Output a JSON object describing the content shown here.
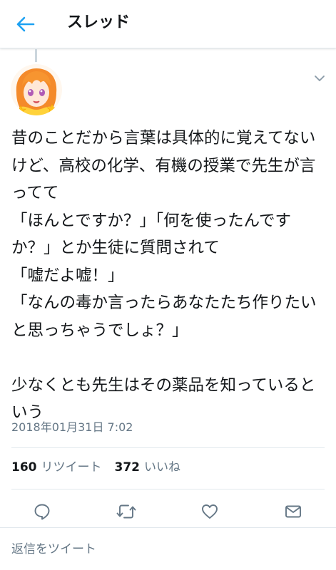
{
  "header": {
    "title": "スレッド"
  },
  "tweet": {
    "text": "昔のことだから言葉は具体的に覚えてないけど、高校の化学、有機の授業で先生が言ってて\n「ほんとですか？」「何を使ったんですか？」とか生徒に質問されて\n「嘘だよ嘘！」\n「なんの毒か言ったらあなたたち作りたいと思っちゃうでしょ？」\n\n少なくとも先生はその薬品を知っているという",
    "timestamp": "2018年01月31日 7:02",
    "retweets": {
      "count": "160",
      "label": "リツイート"
    },
    "likes": {
      "count": "372",
      "label": "いいね"
    }
  },
  "reply": {
    "placeholder": "返信をツイート"
  },
  "icons": {
    "back": "back-arrow-icon",
    "menu": "chevron-down-icon",
    "reply": "reply-icon",
    "retweet": "retweet-icon",
    "like": "heart-icon",
    "message": "envelope-icon"
  },
  "colors": {
    "accent": "#1da1f2",
    "text": "#14171a",
    "muted": "#657786",
    "divider": "#e1e8ed"
  }
}
